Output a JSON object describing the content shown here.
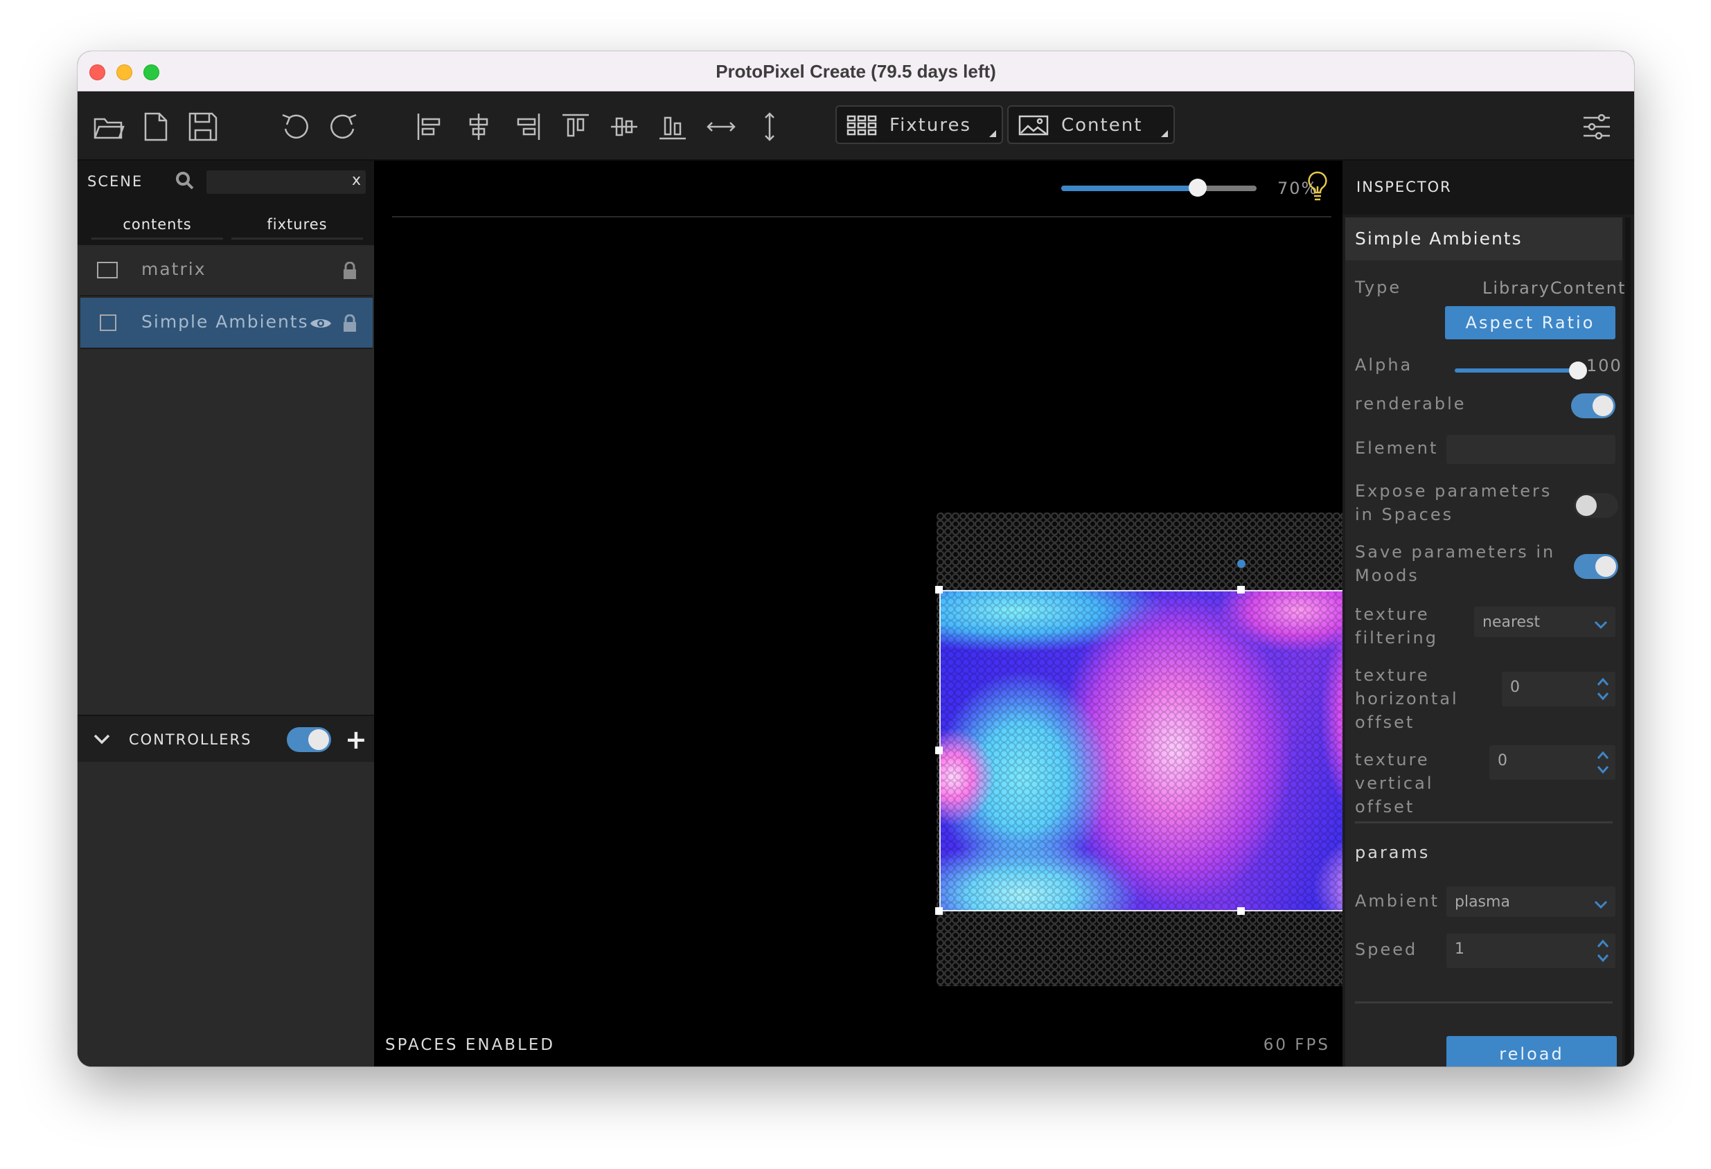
{
  "window": {
    "title": "ProtoPixel Create (79.5 days left)"
  },
  "toolbar": {
    "icons": [
      "open-folder-icon",
      "new-file-icon",
      "save-icon",
      "undo-icon",
      "redo-icon",
      "align-left-icon",
      "align-center-horizontal-icon",
      "align-right-icon",
      "align-top-icon",
      "align-center-vertical-icon",
      "align-bottom-icon",
      "distribute-horizontal-icon",
      "distribute-vertical-icon",
      "settings-sliders-icon"
    ],
    "fixtures_label": "Fixtures",
    "content_label": "Content"
  },
  "scene": {
    "title": "SCENE",
    "search_placeholder": "",
    "search_clear": "x",
    "tabs": [
      {
        "label": "contents"
      },
      {
        "label": "fixtures"
      }
    ],
    "items": [
      {
        "name": "matrix",
        "selected": false
      },
      {
        "name": "Simple Ambients",
        "selected": true
      }
    ]
  },
  "controllers": {
    "title": "CONTROLLERS",
    "enabled": true,
    "add": "+"
  },
  "canvas": {
    "zoom_percent": 70,
    "zoom_label": "70%",
    "spaces_status": "SPACES ENABLED",
    "fps": "60 FPS"
  },
  "inspector": {
    "title": "INSPECTOR",
    "selected_name": "Simple Ambients",
    "type_label": "Type",
    "type_value": "LibraryContent",
    "aspect_ratio_button": "Aspect Ratio",
    "alpha_label": "Alpha",
    "alpha_value": "100",
    "renderable_label": "renderable",
    "renderable": true,
    "element_label": "Element",
    "element_value": "",
    "expose_label": "Expose parameters in Spaces",
    "expose": false,
    "save_label": "Save parameters in Moods",
    "save": true,
    "filtering_label": "texture filtering",
    "filtering_value": "nearest",
    "h_offset_label": "texture horizontal offset",
    "h_offset_value": "0",
    "v_offset_label": "texture vertical offset",
    "v_offset_value": "0",
    "params_title": "params",
    "ambient_label": "Ambient",
    "ambient_value": "plasma",
    "speed_label": "Speed",
    "speed_value": "1",
    "reload_button": "reload"
  },
  "colors": {
    "accent": "#3d86c8",
    "selection": "#2f5478",
    "panel": "#2a2a2a"
  }
}
